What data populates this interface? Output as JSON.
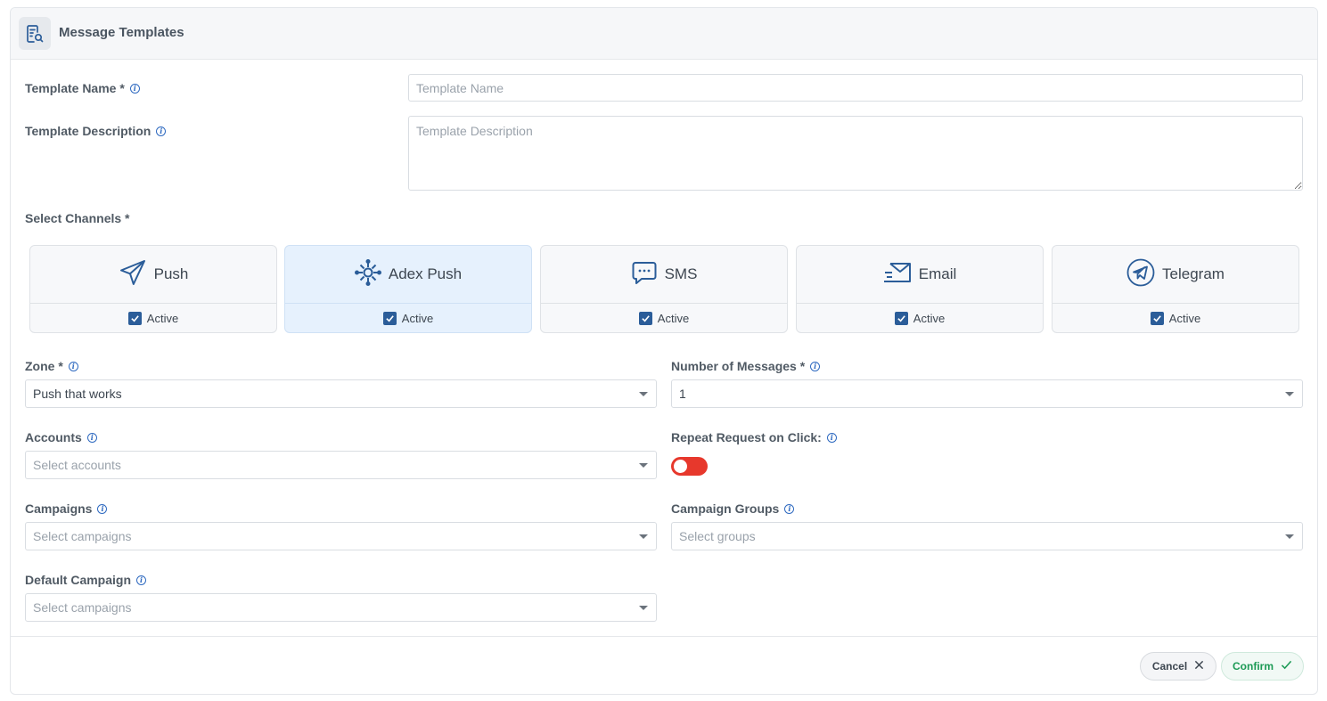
{
  "header": {
    "title": "Message Templates",
    "icon": "document-search-icon"
  },
  "form": {
    "template_name": {
      "label": "Template Name *",
      "placeholder": "Template Name",
      "value": ""
    },
    "template_description": {
      "label": "Template Description",
      "placeholder": "Template Description",
      "value": ""
    },
    "select_channels": {
      "label": "Select Channels *"
    },
    "channels": [
      {
        "name": "Push",
        "icon": "paper-plane-icon",
        "checkbox_label": "Active",
        "checked": true,
        "selected": false
      },
      {
        "name": "Adex Push",
        "icon": "burst-network-icon",
        "checkbox_label": "Active",
        "checked": true,
        "selected": true
      },
      {
        "name": "SMS",
        "icon": "chat-bubble-icon",
        "checkbox_label": "Active",
        "checked": true,
        "selected": false
      },
      {
        "name": "Email",
        "icon": "envelope-icon",
        "checkbox_label": "Active",
        "checked": true,
        "selected": false
      },
      {
        "name": "Telegram",
        "icon": "telegram-icon",
        "checkbox_label": "Active",
        "checked": true,
        "selected": false
      }
    ],
    "zone": {
      "label": "Zone *",
      "value": "Push that works"
    },
    "number_of_messages": {
      "label": "Number of Messages *",
      "value": "1"
    },
    "accounts": {
      "label": "Accounts",
      "placeholder": "Select accounts"
    },
    "repeat_request": {
      "label": "Repeat Request on Click:",
      "enabled": false,
      "color": "#e7382c"
    },
    "campaigns": {
      "label": "Campaigns",
      "placeholder": "Select campaigns"
    },
    "campaign_groups": {
      "label": "Campaign Groups",
      "placeholder": "Select groups"
    },
    "default_campaign": {
      "label": "Default Campaign",
      "placeholder": "Select campaigns"
    }
  },
  "footer": {
    "cancel_label": "Cancel",
    "confirm_label": "Confirm"
  },
  "colors": {
    "accent": "#2b5d99",
    "selected_channel_bg": "#e6f1fd",
    "confirm_text": "#1c9a55"
  }
}
